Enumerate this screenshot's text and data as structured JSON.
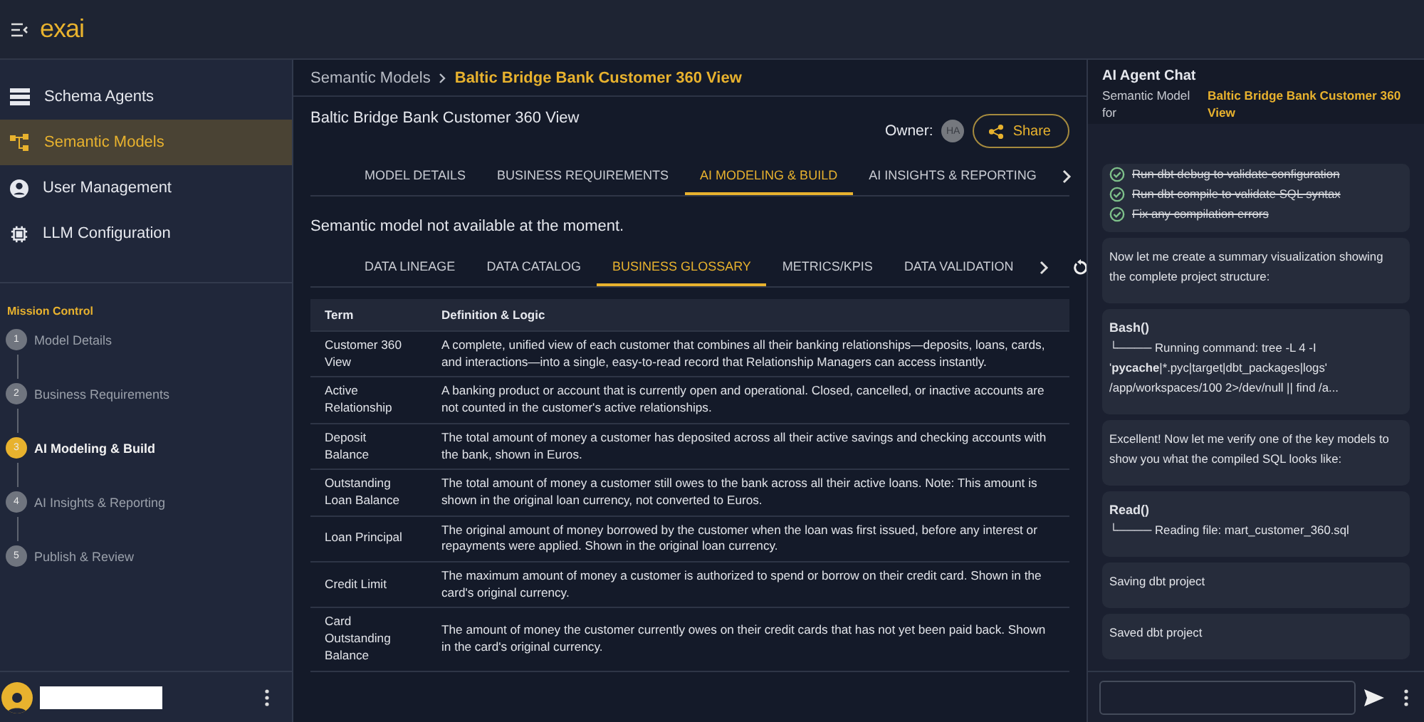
{
  "brand": {
    "logo": "exai"
  },
  "nav": [
    {
      "label": "Schema Agents",
      "selected": false
    },
    {
      "label": "Semantic Models",
      "selected": true
    },
    {
      "label": "User Management",
      "selected": false
    },
    {
      "label": "LLM Configuration",
      "selected": false
    }
  ],
  "mission_control": {
    "title": "Mission Control",
    "steps": [
      {
        "number": "1",
        "label": "Model Details",
        "selected": false
      },
      {
        "number": "2",
        "label": "Business Requirements",
        "selected": false
      },
      {
        "number": "3",
        "label": "AI Modeling & Build",
        "selected": true
      },
      {
        "number": "4",
        "label": "AI Insights & Reporting",
        "selected": false
      },
      {
        "number": "5",
        "label": "Publish & Review",
        "selected": false
      }
    ]
  },
  "breadcrumb": [
    "Semantic Models",
    "Baltic Bridge Bank Customer 360 View"
  ],
  "model_title": "Baltic Bridge Bank Customer 360 View",
  "owner": {
    "label": "Owner:",
    "initials": "HA"
  },
  "share_button": "Share",
  "tabs": [
    {
      "label": "MODEL DETAILS",
      "selected": false
    },
    {
      "label": "BUSINESS REQUIREMENTS",
      "selected": false
    },
    {
      "label": "AI MODELING & BUILD",
      "selected": true
    },
    {
      "label": "AI INSIGHTS & REPORTING",
      "selected": false
    }
  ],
  "notice": "Semantic model not available at the moment.",
  "subtabs": [
    {
      "label": "DATA LINEAGE",
      "selected": false
    },
    {
      "label": "DATA CATALOG",
      "selected": false
    },
    {
      "label": "BUSINESS GLOSSARY",
      "selected": true
    },
    {
      "label": "METRICS/KPIS",
      "selected": false
    },
    {
      "label": "DATA VALIDATION",
      "selected": false
    }
  ],
  "table": {
    "columns": [
      "Term",
      "Definition & Logic"
    ],
    "rows": [
      [
        "Customer 360 View",
        "A complete, unified view of each customer that combines all their banking relationships—deposits, loans, cards, and interactions—into a single, easy-to-read record that Relationship Managers can access instantly."
      ],
      [
        "Active Relationship",
        "A banking product or account that is currently open and operational. Closed, cancelled, or inactive accounts are not counted in the customer's active relationships."
      ],
      [
        "Deposit Balance",
        "The total amount of money a customer has deposited across all their active savings and checking accounts with the bank, shown in Euros."
      ],
      [
        "Outstanding Loan Balance",
        "The total amount of money a customer still owes to the bank across all their active loans. Note: This amount is shown in the original loan currency, not converted to Euros."
      ],
      [
        "Loan Principal",
        "The original amount of money borrowed by the customer when the loan was first issued, before any interest or repayments were applied. Shown in the original loan currency."
      ],
      [
        "Credit Limit",
        "The maximum amount of money a customer is authorized to spend or borrow on their credit card. Shown in the card's original currency."
      ],
      [
        "Card Outstanding Balance",
        "The amount of money the customer currently owes on their credit cards that has not yet been paid back. Shown in the card's original currency."
      ]
    ]
  },
  "chat": {
    "title": "AI Agent Chat",
    "subtitle_label": "Semantic Model for",
    "subtitle_value": "Baltic Bridge Bank Customer 360 View",
    "messages": [
      {
        "kind": "checklist",
        "items": [
          {
            "text": "Run dbt debug to validate configuration",
            "checked": true
          },
          {
            "text": "Run dbt compile to validate SQL syntax",
            "checked": true
          },
          {
            "text": "Fix any compilation errors",
            "checked": true
          }
        ]
      },
      {
        "kind": "text",
        "text": "Now let me create a summary visualization showing the complete project structure:"
      },
      {
        "kind": "tool",
        "title": "Bash()",
        "text": "└──── Running command: tree -L 4 -I '**pycache**|*.pyc|target|dbt_packages|logs' /app/workspaces/100 2>/dev/null || find /a..."
      },
      {
        "kind": "text",
        "text": "Excellent! Now let me verify one of the key models to show you what the compiled SQL looks like:"
      },
      {
        "kind": "tool",
        "title": "Read()",
        "text": "└──── Reading file: mart_customer_360.sql"
      },
      {
        "kind": "text",
        "text": "Saving dbt project"
      },
      {
        "kind": "text",
        "text": "Saved dbt project"
      }
    ]
  }
}
